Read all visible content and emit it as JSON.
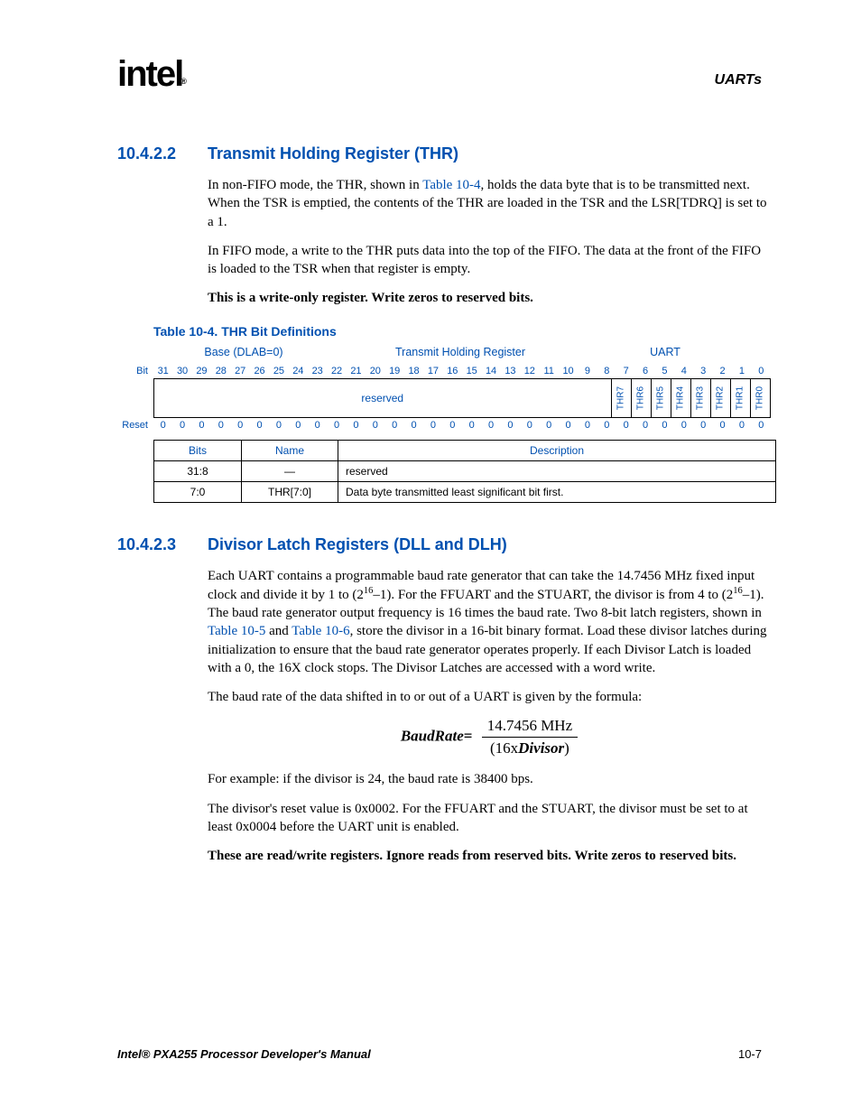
{
  "header": {
    "logo_text": "intel",
    "right": "UARTs"
  },
  "section1": {
    "num": "10.4.2.2",
    "title": "Transmit Holding Register (THR)",
    "para1_a": "In non-FIFO mode, the THR, shown in ",
    "para1_link": "Table 10-4",
    "para1_b": ", holds the data byte that is to be transmitted next. When the TSR is emptied, the contents of the THR are loaded in the TSR and the LSR[TDRQ] is set to a 1.",
    "para2": "In FIFO mode, a write to the THR puts data into the top of the FIFO. The data at the front of the FIFO is loaded to the TSR when that register is empty.",
    "para3": "This is a write-only register. Write zeros to reserved bits."
  },
  "table_caption": "Table 10-4. THR Bit Definitions",
  "reg": {
    "top_left": "Base (DLAB=0)",
    "top_mid": "Transmit Holding Register",
    "top_right": "UART",
    "bit_label": "Bit",
    "reset_label": "Reset",
    "bits": [
      "31",
      "30",
      "29",
      "28",
      "27",
      "26",
      "25",
      "24",
      "23",
      "22",
      "21",
      "20",
      "19",
      "18",
      "17",
      "16",
      "15",
      "14",
      "13",
      "12",
      "11",
      "10",
      "9",
      "8",
      "7",
      "6",
      "5",
      "4",
      "3",
      "2",
      "1",
      "0"
    ],
    "reserved_text": "reserved",
    "thr_fields": [
      "THR7",
      "THR6",
      "THR5",
      "THR4",
      "THR3",
      "THR2",
      "THR1",
      "THR0"
    ],
    "reset_values": [
      "0",
      "0",
      "0",
      "0",
      "0",
      "0",
      "0",
      "0",
      "0",
      "0",
      "0",
      "0",
      "0",
      "0",
      "0",
      "0",
      "0",
      "0",
      "0",
      "0",
      "0",
      "0",
      "0",
      "0",
      "0",
      "0",
      "0",
      "0",
      "0",
      "0",
      "0",
      "0"
    ]
  },
  "desc_table": {
    "headers": [
      "Bits",
      "Name",
      "Description"
    ],
    "rows": [
      {
        "bits": "31:8",
        "name": "—",
        "desc": "reserved"
      },
      {
        "bits": "7:0",
        "name": "THR[7:0]",
        "desc": "Data byte transmitted least significant bit first."
      }
    ]
  },
  "section2": {
    "num": "10.4.2.3",
    "title": "Divisor Latch Registers (DLL and DLH)",
    "para1_a": "Each UART contains a programmable baud rate generator that can take the 14.7456 MHz fixed input clock and divide it by 1 to (2",
    "para1_sup1": "16",
    "para1_b": "–1). For the FFUART and the STUART, the divisor is from 4 to (2",
    "para1_sup2": "16",
    "para1_c": "–1). The baud rate generator output frequency is 16 times the baud rate. Two 8-bit latch registers, shown in ",
    "para1_link1": "Table 10-5",
    "para1_d": " and ",
    "para1_link2": "Table 10-6",
    "para1_e": ", store the divisor in a 16-bit binary format. Load these divisor latches during initialization to ensure that the baud rate generator operates properly. If each Divisor Latch is loaded with a 0, the 16X clock stops. The Divisor Latches are accessed with a word write.",
    "para2": "The baud rate of the data shifted in to or out of a UART is given by the formula:",
    "formula_lhs": "BaudRate",
    "formula_num": "14.7456 MHz",
    "formula_den_a": "(16x",
    "formula_den_b": "Divisor",
    "formula_den_c": ")",
    "para3": "For example: if the divisor is 24, the baud rate is 38400 bps.",
    "para4": "The divisor's reset value is 0x0002. For the FFUART and the STUART, the divisor must be set to at least 0x0004 before the UART unit is enabled.",
    "para5": "These are read/write registers. Ignore reads from reserved bits. Write zeros to reserved bits."
  },
  "footer": {
    "title": "Intel® PXA255 Processor Developer's Manual",
    "page": "10-7"
  }
}
